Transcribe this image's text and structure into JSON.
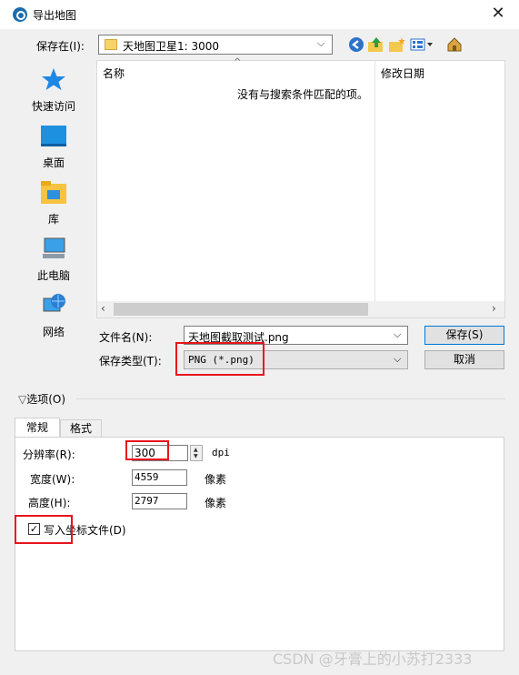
{
  "window": {
    "title": "导出地图",
    "close": "✕"
  },
  "toolbar": {
    "save_in_label": "保存在(I):",
    "path": "天地图卫星1: 3000",
    "buttons": [
      "back-icon",
      "up-folder-icon",
      "new-folder-icon",
      "view-menu-icon",
      "home-icon"
    ]
  },
  "places": [
    "快速访问",
    "桌面",
    "库",
    "此电脑",
    "网络"
  ],
  "filelist": {
    "col_name": "名称",
    "col_date": "修改日期",
    "empty": "没有与搜索条件匹配的项。"
  },
  "filename": {
    "label": "文件名(N):",
    "value": "天地图截取测试.png"
  },
  "filetype": {
    "label": "保存类型(T):",
    "value": "PNG (*.png)"
  },
  "buttons": {
    "save": "保存(S)",
    "cancel": "取消"
  },
  "options": {
    "toggle": "选项(O)",
    "tabs": [
      "常规",
      "格式"
    ],
    "resolution": {
      "label": "分辨率(R):",
      "value": "300",
      "unit": "dpi"
    },
    "width": {
      "label": "宽度(W):",
      "value": "4559",
      "unit": "像素"
    },
    "height": {
      "label": "高度(H):",
      "value": "2797",
      "unit": "像素"
    },
    "world_file": {
      "label": "写入坐标文件(D)",
      "checked": true
    }
  },
  "watermark": "CSDN @牙膏上的小苏打2333"
}
